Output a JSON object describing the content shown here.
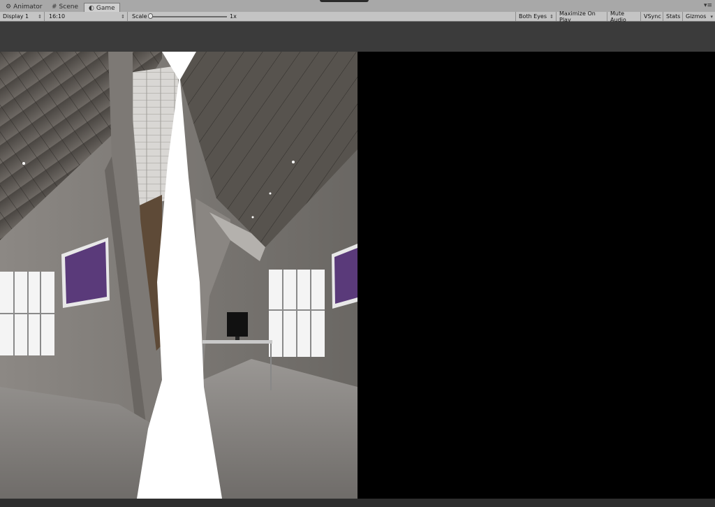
{
  "tabs": [
    {
      "label": "Animator",
      "icon": "animator-icon",
      "active": false
    },
    {
      "label": "Scene",
      "icon": "scene-grid-icon",
      "active": false
    },
    {
      "label": "Game",
      "icon": "game-icon",
      "active": true
    }
  ],
  "toolbar": {
    "display": "Display 1",
    "aspect": "16:10",
    "scale_label": "Scale",
    "scale_value": "1x",
    "eyes": "Both Eyes",
    "maximize": "Maximize On Play",
    "mute": "Mute Audio",
    "vsync": "VSync",
    "stats": "Stats",
    "gizmos": "Gizmos"
  },
  "colors": {
    "tab_bar": "#a8a8a8",
    "toolbar": "#c4c4c4",
    "view_bg": "#3b3b3b",
    "render_black": "#000000"
  }
}
